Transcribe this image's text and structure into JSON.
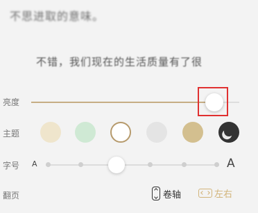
{
  "reader": {
    "line1": "不思进取的意味。",
    "line2": "不错，我们现在的生活质量有了很"
  },
  "settings": {
    "brightness": {
      "label": "亮度",
      "level": 0.88
    },
    "theme": {
      "label": "主题",
      "options": [
        {
          "name": "beige",
          "color": "#efe5cc"
        },
        {
          "name": "green",
          "color": "#cfe9d4"
        },
        {
          "name": "white",
          "color": "#ffffff",
          "selected": true
        },
        {
          "name": "gray",
          "color": "#e4e4e4"
        },
        {
          "name": "tan",
          "color": "#d3bf8f"
        },
        {
          "name": "night",
          "color": "#333333",
          "icon": "moon-icon"
        }
      ]
    },
    "font_size": {
      "label": "字号",
      "small_label": "A",
      "large_label": "A",
      "level_index": 3,
      "steps": 7
    },
    "page_turn": {
      "label": "翻页",
      "scroll": "卷轴",
      "left_right": "左右",
      "selected": "left_right"
    }
  },
  "colors": {
    "accent": "#c6ad84",
    "highlight": "#e03030",
    "selected_mode": "#d2b47a"
  }
}
